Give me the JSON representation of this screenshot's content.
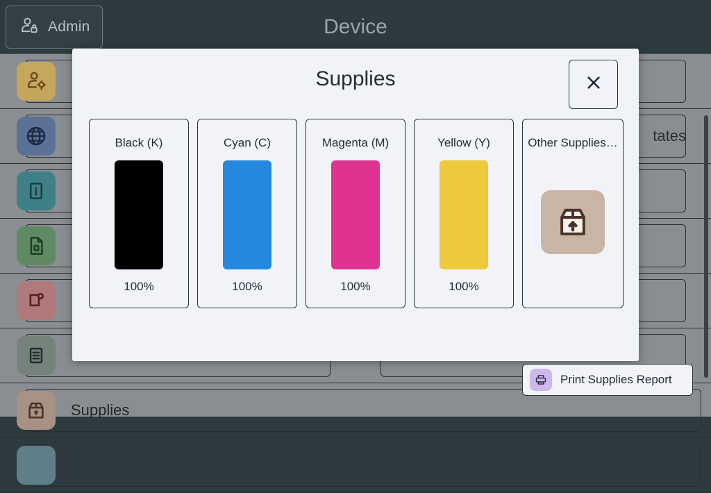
{
  "topbar": {
    "admin_label": "Admin",
    "admin_icon": "user-lock-icon",
    "title": "Device"
  },
  "background_rows": [
    {
      "id": "row-user-settings",
      "icon": "user-settings-icon",
      "tile_color": "#c4a75a",
      "icon_color": "#6b4b21",
      "label": "",
      "right_label": ""
    },
    {
      "id": "row-network",
      "icon": "globe-icon",
      "tile_color": "#5b7296",
      "icon_color": "#1d2a44",
      "label": "",
      "right_label": "tates"
    },
    {
      "id": "row-info",
      "icon": "info-icon",
      "tile_color": "#3f8088",
      "icon_color": "#1b3b40",
      "label": "",
      "right_label": ""
    },
    {
      "id": "row-report",
      "icon": "document-icon",
      "tile_color": "#5f8a64",
      "icon_color": "#1f3d22",
      "label": "",
      "right_label": ""
    },
    {
      "id": "row-alerts",
      "icon": "alert-page-icon",
      "tile_color": "#b07a7d",
      "icon_color": "#5a1f23",
      "label": "",
      "right_label": ""
    },
    {
      "id": "row-logs",
      "icon": "list-icon",
      "tile_color": "#76837c",
      "icon_color": "#22302a",
      "label": "",
      "right_label": ""
    }
  ],
  "supplies_row": {
    "id": "row-supplies",
    "icon": "supplies-box-icon",
    "tile_color": "#a79285",
    "icon_color": "#4a342a",
    "label": "Supplies"
  },
  "last_row": {
    "id": "row-partial",
    "icon": "generic-icon",
    "tile_color": "#5f7e88",
    "icon_color": "#1f3b42"
  },
  "modal": {
    "title": "Supplies",
    "close_icon": "close-icon",
    "close_label": "",
    "cards": [
      {
        "name": "Black (K)",
        "percent": "100%",
        "color": "#000000",
        "type": "bar"
      },
      {
        "name": "Cyan (C)",
        "percent": "100%",
        "color": "#2488de",
        "type": "bar"
      },
      {
        "name": "Magenta (M)",
        "percent": "100%",
        "color": "#de3391",
        "type": "bar"
      },
      {
        "name": "Yellow (Y)",
        "percent": "100%",
        "color": "#edc93c",
        "type": "bar"
      },
      {
        "name": "Other Supplies…",
        "percent": "",
        "color": "#c9b5a5",
        "type": "icon",
        "icon": "supplies-box-icon"
      }
    ],
    "print_button": {
      "label": "Print Supplies Report",
      "icon": "printer-icon",
      "icon_bg": "#cdb9ea"
    }
  },
  "theme": {
    "header_bg": "#2d3a40",
    "content_bg": "#8a8d91",
    "modal_bg": "#f1f3f8",
    "text_dark": "#262d33"
  }
}
